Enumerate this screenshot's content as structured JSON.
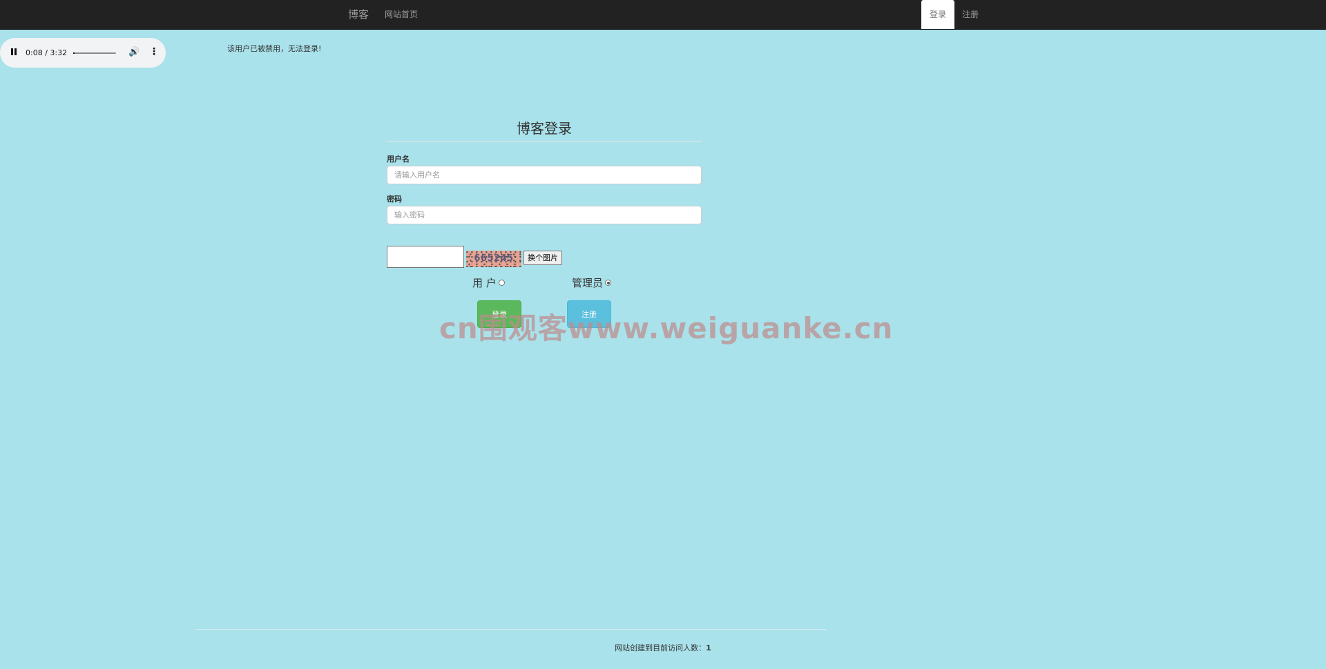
{
  "navbar": {
    "brand": "博客",
    "home": "网站首页",
    "login": "登录",
    "register": "注册"
  },
  "audio": {
    "time": "0:08 / 3:32",
    "progress_fraction": 0.038,
    "play_icon": "pause-icon",
    "volume_icon": "volume-icon",
    "more_icon": "more-vert-icon"
  },
  "alert": "该用户已被禁用，无法登录!",
  "form": {
    "title": "博客登录",
    "username_label": "用户名",
    "username_placeholder": "请输入用户名",
    "password_label": "密码",
    "password_placeholder": "输入密码",
    "captcha_text": "665245",
    "captcha_refresh": "换个图片",
    "role_user": "用 户",
    "role_admin": "管理员",
    "role_selected": "admin",
    "login_button": "登录",
    "register_button": "注册"
  },
  "watermark": "cn围观客www.weiguanke.cn",
  "footer": {
    "label": "网站创建到目前访问人数：",
    "count": "1"
  }
}
